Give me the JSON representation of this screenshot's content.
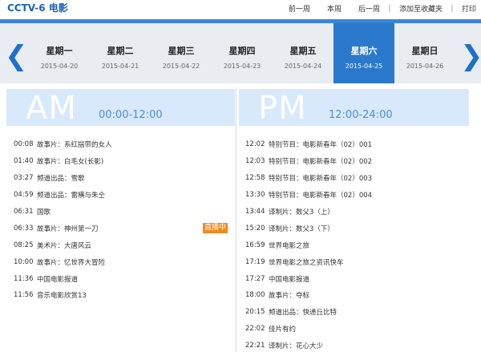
{
  "header": {
    "channel": "CCTV-6 电影",
    "links": {
      "prev_week": "前一周",
      "this_week": "本周",
      "next_week": "后一周",
      "separator": "|",
      "bookmark": "添加至收藏夹",
      "print": "打印"
    }
  },
  "nav": {
    "left_arrow": "❮",
    "right_arrow": "❯",
    "days": [
      {
        "name": "星期一",
        "date": "2015-04-20"
      },
      {
        "name": "星期二",
        "date": "2015-04-21"
      },
      {
        "name": "星期三",
        "date": "2015-04-22"
      },
      {
        "name": "星期四",
        "date": "2015-04-23"
      },
      {
        "name": "星期五",
        "date": "2015-04-24"
      },
      {
        "name": "星期六",
        "date": "2015-04-25"
      },
      {
        "name": "星期日",
        "date": "2015-04-26"
      }
    ],
    "active_day": "星期六"
  },
  "am": {
    "big": "AM",
    "range": "00:00-12:00",
    "programs": [
      {
        "time": "00:08",
        "title": "故事片：系红揣带的女人"
      },
      {
        "time": "01:40",
        "title": "故事片：白毛女(长影)"
      },
      {
        "time": "03:27",
        "title": "频道出品：雪歌"
      },
      {
        "time": "04:59",
        "title": "频道出品：雷横与朱仝"
      },
      {
        "time": "06:31",
        "title": "国歌"
      },
      {
        "time": "06:33",
        "title": "故事片：神州第一刀",
        "badge": "直播中"
      },
      {
        "time": "08:25",
        "title": "美术片：大唐风云"
      },
      {
        "time": "10:00",
        "title": "故事片：忆世界大冒险"
      },
      {
        "time": "11:36",
        "title": "中国电影报道"
      },
      {
        "time": "11:56",
        "title": "音乐电影欣赏13"
      }
    ]
  },
  "pm": {
    "big": "PM",
    "range": "12:00-24:00",
    "programs": [
      {
        "time": "12:02",
        "title": "特别节目：电影新春年（02）001"
      },
      {
        "time": "12:03",
        "title": "特别节目：电影新春年（02）002"
      },
      {
        "time": "12:58",
        "title": "特别节目：电影新春年（02）003"
      },
      {
        "time": "13:30",
        "title": "特别节目：电影新春年（02）004"
      },
      {
        "time": "13:44",
        "title": "译制片：数父3（上）"
      },
      {
        "time": "15:20",
        "title": "译制片：数父3（下）"
      },
      {
        "time": "16:59",
        "title": "世界电影之旅"
      },
      {
        "time": "17:19",
        "title": "世界电影之旅之资讯快车"
      },
      {
        "time": "17:27",
        "title": "中国电影报道"
      },
      {
        "time": "18:00",
        "title": "故事片：夺标"
      },
      {
        "time": "20:15",
        "title": "频道出品：快递丘比特"
      },
      {
        "time": "22:02",
        "title": "佳片有约"
      },
      {
        "time": "22:21",
        "title": "译制片：花心大少"
      }
    ]
  },
  "colors": {
    "accent": "#2a79cc",
    "title": "#1a63b8",
    "badge": "#f08b1f",
    "header_bg": "#d8e9fb"
  }
}
